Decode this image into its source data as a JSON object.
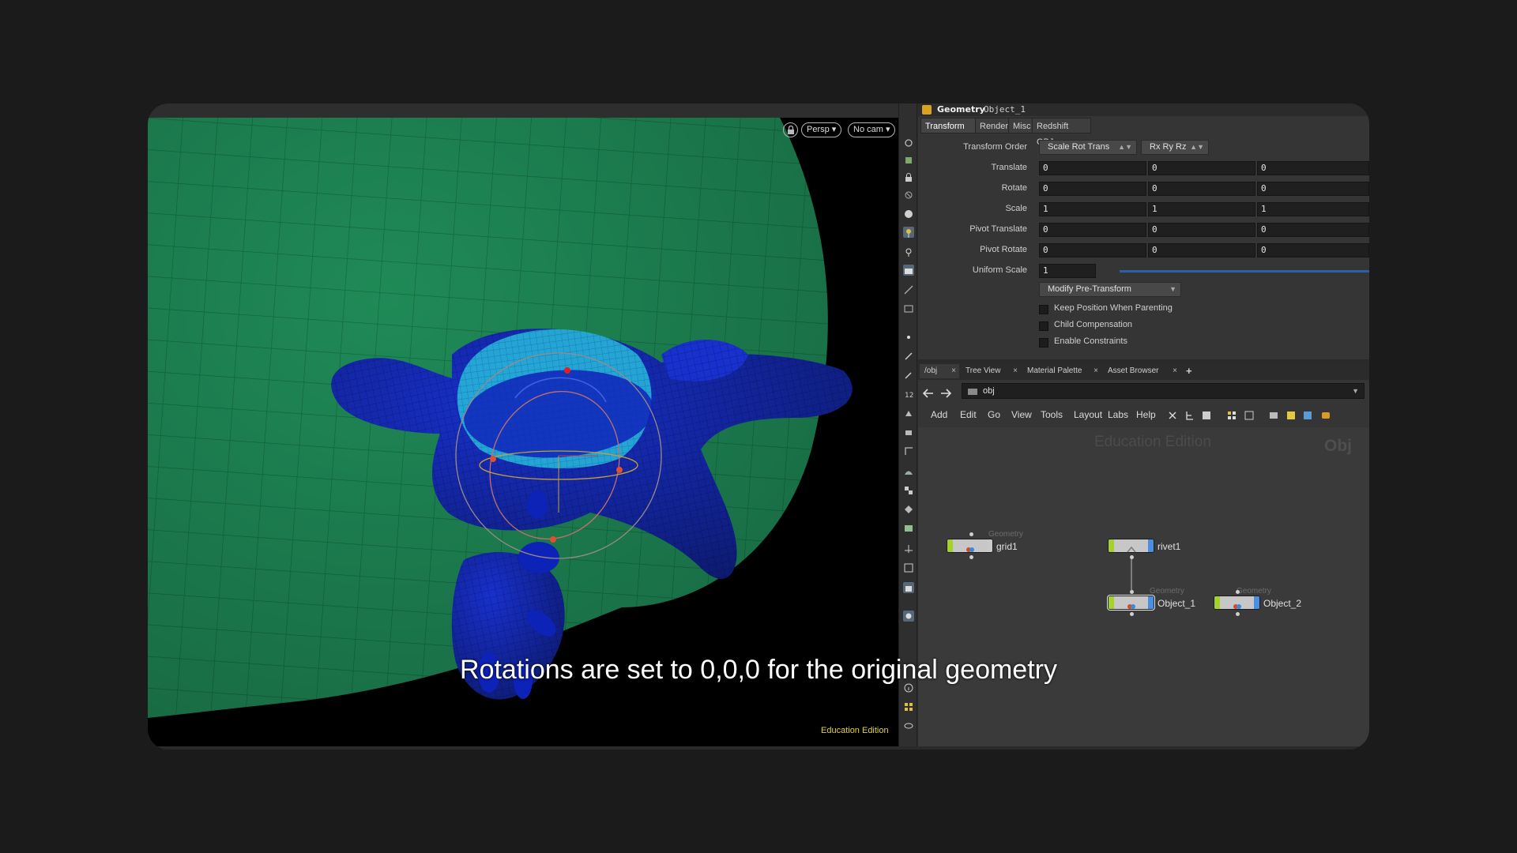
{
  "viewport": {
    "view_menu": "Persp ▾",
    "cam_menu": "No cam ▾",
    "watermark": "Education Edition"
  },
  "parameters": {
    "node_type": "Geometry",
    "node_name": "Object_1",
    "tabs": [
      "Transform",
      "Render",
      "Misc",
      "Redshift OBJ"
    ],
    "transform_order_label": "Transform Order",
    "transform_order": "Scale Rot Trans",
    "rotate_order": "Rx Ry Rz",
    "rows": [
      {
        "label": "Translate",
        "values": [
          "0",
          "0",
          "0"
        ]
      },
      {
        "label": "Rotate",
        "values": [
          "0",
          "0",
          "0"
        ]
      },
      {
        "label": "Scale",
        "values": [
          "1",
          "1",
          "1"
        ]
      },
      {
        "label": "Pivot Translate",
        "values": [
          "0",
          "0",
          "0"
        ]
      },
      {
        "label": "Pivot Rotate",
        "values": [
          "0",
          "0",
          "0"
        ]
      }
    ],
    "uniform_scale_label": "Uniform Scale",
    "uniform_scale": "1",
    "pretransform_menu": "Modify Pre-Transform",
    "checkboxes": [
      "Keep Position When Parenting",
      "Child Compensation",
      "Enable Constraints"
    ]
  },
  "network": {
    "tabs": [
      "/obj",
      "Tree View",
      "Material Palette",
      "Asset Browser"
    ],
    "add_tab": "+",
    "path": "obj",
    "menu": [
      "Add",
      "Edit",
      "Go",
      "View",
      "Tools",
      "Layout",
      "Labs",
      "Help"
    ],
    "watermark": "Education Edition",
    "context_label": "Obj",
    "nodes": [
      {
        "name": "grid1",
        "type": "Geometry",
        "flag_color": "#c9c9c9"
      },
      {
        "name": "rivet1",
        "type": "",
        "flag_color": "#4a8fe0"
      },
      {
        "name": "Object_1",
        "type": "Geometry",
        "flag_color": "#4a8fe0"
      },
      {
        "name": "Object_2",
        "type": "Geometry",
        "flag_color": "#4a8fe0"
      }
    ]
  },
  "caption": "Rotations are set to 0,0,0 for the original geometry",
  "colors": {
    "grid_green": "#1f8a57",
    "geo_blue": "#1428c8",
    "selection_cyan": "#1fb4d8",
    "accent_yellow": "#e2d23b"
  }
}
